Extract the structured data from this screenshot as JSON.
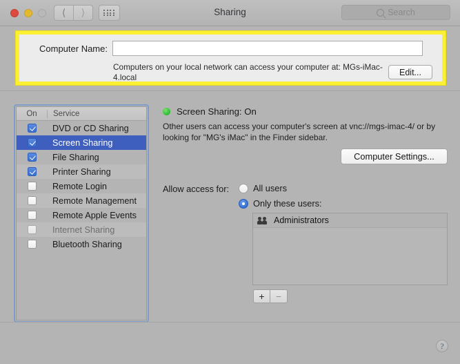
{
  "window": {
    "title": "Sharing"
  },
  "titlebar": {
    "back_icon": "chevron-left-icon",
    "forward_icon": "chevron-right-icon",
    "grid_icon": "grid-icon",
    "search_placeholder": "Search",
    "search_value": ""
  },
  "computer_name_section": {
    "label": "Computer Name:",
    "value": "",
    "placeholder": "",
    "note": "Computers on your local network can access your computer at: MGs-iMac-4.local",
    "hostname": "MGs-iMac-4.local",
    "edit_label": "Edit...",
    "highlight_color": "#fcf035"
  },
  "services": {
    "columns": {
      "on": "On",
      "service": "Service"
    },
    "rows": [
      {
        "label": "DVD or CD Sharing",
        "checked": true,
        "selected": false,
        "disabled": false
      },
      {
        "label": "Screen Sharing",
        "checked": true,
        "selected": true,
        "disabled": false
      },
      {
        "label": "File Sharing",
        "checked": true,
        "selected": false,
        "disabled": false
      },
      {
        "label": "Printer Sharing",
        "checked": true,
        "selected": false,
        "disabled": false
      },
      {
        "label": "Remote Login",
        "checked": false,
        "selected": false,
        "disabled": false
      },
      {
        "label": "Remote Management",
        "checked": false,
        "selected": false,
        "disabled": false
      },
      {
        "label": "Remote Apple Events",
        "checked": false,
        "selected": false,
        "disabled": false
      },
      {
        "label": "Internet Sharing",
        "checked": false,
        "selected": false,
        "disabled": true
      },
      {
        "label": "Bluetooth Sharing",
        "checked": false,
        "selected": false,
        "disabled": false
      }
    ]
  },
  "detail": {
    "status_label": "Screen Sharing: On",
    "status_color": "#2dbc2f",
    "description": "Other users can access your computer's screen at vnc://mgs-imac-4/ or by looking for \"MG's iMac\" in the Finder sidebar.",
    "computer_settings_label": "Computer Settings...",
    "allow_access_label": "Allow access for:",
    "radio_options": [
      {
        "label": "All users",
        "selected": false
      },
      {
        "label": "Only these users:",
        "selected": true
      }
    ],
    "users": [
      {
        "name": "Administrators",
        "icon": "group-icon"
      }
    ],
    "add_label": "+",
    "remove_label": "−"
  },
  "footer": {
    "help_label": "?"
  }
}
